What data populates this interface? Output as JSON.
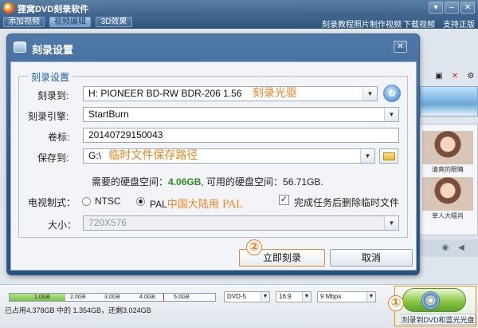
{
  "app": {
    "title": "狸窝DVD刻录软件",
    "window_buttons": [
      "▾",
      "–",
      "✕"
    ],
    "modes": [
      "添加视频",
      "视频编辑",
      "3D效果"
    ],
    "top_links": [
      "刻录教程",
      "照片制作视频",
      "下载视频",
      "支持正版"
    ]
  },
  "right_panel": {
    "thumb_captions": [
      "清爽的眼睛",
      "单人大幅肖"
    ]
  },
  "dialog": {
    "title": "刻录设置",
    "close": "✕",
    "group_title": "刻录设置",
    "burn_to": {
      "label": "刻录到:",
      "value": "H: PIONEER BD-RW   BDR-206 1.56",
      "annotation": "刻录光驱"
    },
    "engine": {
      "label": "刻录引擎:",
      "value": "StartBurn"
    },
    "volume": {
      "label": "卷标:",
      "value": "20140729150043"
    },
    "save_to": {
      "label": "保存到:",
      "value": "G:\\",
      "annotation": "临时文件保存路径"
    },
    "disk_space": {
      "prefix": "需要的硬盘空间：",
      "needed": "4.06GB",
      "middle": ", 可用的硬盘空间：",
      "available": "56.71GB."
    },
    "tv_system": {
      "label": "电视制式：",
      "options": [
        "NTSC",
        "PAL"
      ],
      "selected": "PAL",
      "annotation": "中国大陆用 PAL"
    },
    "delete_temp": {
      "label": "完成任务后删除临时文件",
      "checked": true
    },
    "size": {
      "label": "大小：",
      "value": "720X576"
    },
    "buttons": {
      "burn_now": "立即刻录",
      "cancel": "取消"
    },
    "marker_burn_now": "②"
  },
  "bottom": {
    "capacity_ticks": [
      "1.0GB",
      "2.0GB",
      "3.0GB",
      "4.0GB",
      "5.0GB"
    ],
    "capacity_fill_fraction": 0.27,
    "capacity_text": "已占用4.378GB 中的 1.354GB，还剩3.024GB",
    "disc_type": "DVD-5",
    "aspect": "16:9",
    "bitrate": "9 Mbps",
    "burn_button_label": "刻录到DVD和蓝光光盘",
    "marker_burn": "①"
  },
  "colors": {
    "annotation": "#f0821e",
    "accent_blue": "#1f5ea8",
    "title_bar": "#3e628b",
    "needed_space": "#2e8b1f"
  }
}
